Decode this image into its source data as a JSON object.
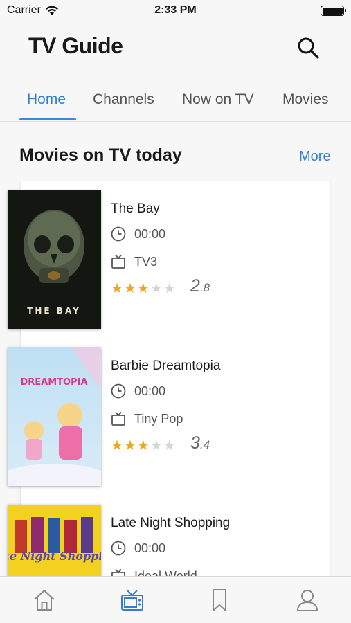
{
  "status_bar": {
    "carrier": "Carrier",
    "time": "2:33 PM"
  },
  "header": {
    "title": "TV Guide"
  },
  "tabs": [
    {
      "label": "Home",
      "active": true
    },
    {
      "label": "Channels",
      "active": false
    },
    {
      "label": "Now on TV",
      "active": false
    },
    {
      "label": "Movies",
      "active": false
    }
  ],
  "section": {
    "title": "Movies on TV today",
    "more_label": "More"
  },
  "movies": [
    {
      "title": "The Bay",
      "time": "00:00",
      "channel": "TV3",
      "rating_int": "2",
      "rating_dec": ".8",
      "stars": 3,
      "poster_text": "THE BAY"
    },
    {
      "title": "Barbie Dreamtopia",
      "time": "00:00",
      "channel": "Tiny Pop",
      "rating_int": "3",
      "rating_dec": ".4",
      "stars": 3,
      "poster_text": "DREAMTOPIA"
    },
    {
      "title": "Late Night Shopping",
      "time": "00:00",
      "channel": "Ideal World",
      "poster_text": "Late Night Shopping"
    }
  ],
  "bottom_nav": [
    {
      "icon": "home-icon",
      "active": false
    },
    {
      "icon": "tv-icon",
      "active": true
    },
    {
      "icon": "bookmark-icon",
      "active": false
    },
    {
      "icon": "profile-icon",
      "active": false
    }
  ],
  "colors": {
    "accent": "#2f7fd9",
    "star": "#f2a523",
    "star_off": "#d5d5d5"
  }
}
